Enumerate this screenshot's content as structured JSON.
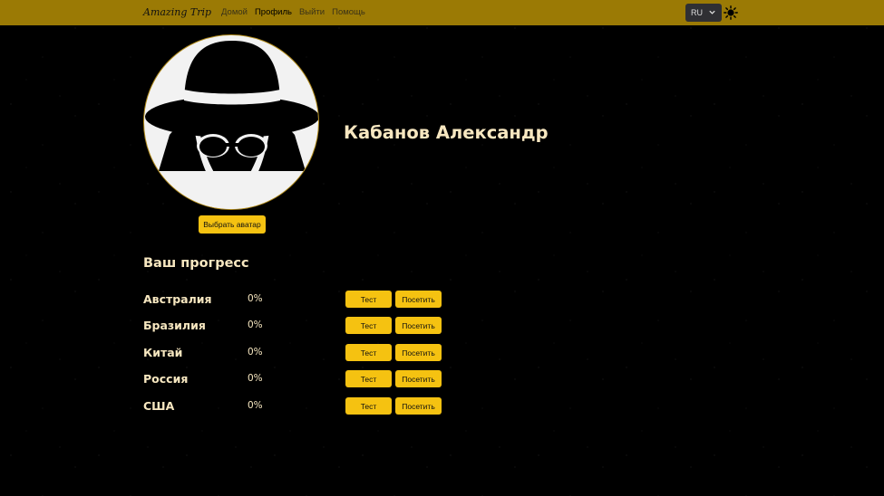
{
  "header": {
    "brand": "Amazing Trip",
    "nav": [
      "Домой",
      "Профиль",
      "Выйти",
      "Помощь"
    ],
    "active_nav": "Профиль",
    "language": "RU",
    "bg_color": "#9b7a05"
  },
  "profile": {
    "name": "Кабанов Александр",
    "choose_avatar_label": "Выбрать аватар",
    "avatar_icon": "spy-avatar-icon"
  },
  "progress": {
    "title": "Ваш прогресс",
    "rows": [
      {
        "country": "Австралия",
        "percent": "0%",
        "test_label": "Тест",
        "visit_label": "Посетить"
      },
      {
        "country": "Бразилия",
        "percent": "0%",
        "test_label": "Тест",
        "visit_label": "Посетить"
      },
      {
        "country": "Китай",
        "percent": "0%",
        "test_label": "Тест",
        "visit_label": "Посетить"
      },
      {
        "country": "Россия",
        "percent": "0%",
        "test_label": "Тест",
        "visit_label": "Посетить"
      },
      {
        "country": "США",
        "percent": "0%",
        "test_label": "Тест",
        "visit_label": "Посетить"
      }
    ]
  },
  "colors": {
    "accent": "#f5c211",
    "text": "#f7e7c0",
    "background": "#000000"
  }
}
